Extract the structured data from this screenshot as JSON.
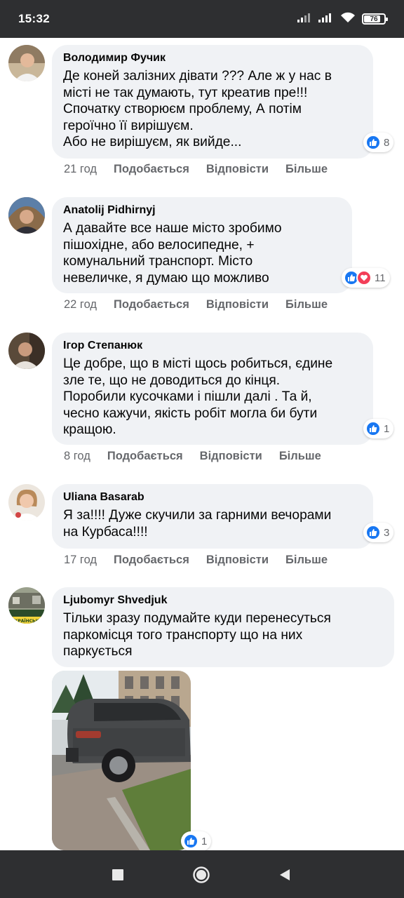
{
  "status_bar": {
    "time": "15:32",
    "battery": "76",
    "battery_level": 0.76
  },
  "comments": [
    {
      "author": "Володимир Фучик",
      "text": "Де коней залізних дівати ??? Але ж у нас в\nмісті не так думають, тут креатив пре!!!\nСпочатку створюєм проблему, А потім\nгероїчно її вирішуєм.\nАбо не вирішуєм, як вийде...",
      "time": "21 год",
      "like": "Подобається",
      "reply": "Відповісти",
      "more": "Більше",
      "reactions": [
        "like-icon"
      ],
      "reaction_count": "8"
    },
    {
      "author": "Anatolij Pidhirnyj",
      "text": "А давайте все наше місто зробимо\nпішохідне, або велосипедне, +\nкомунальний транспорт. Місто\nневеличке, я думаю що можливо",
      "time": "22 год",
      "like": "Подобається",
      "reply": "Відповісти",
      "more": "Більше",
      "reactions": [
        "like-icon",
        "heart-icon"
      ],
      "reaction_count": "11"
    },
    {
      "author": "Ігор Степанюк",
      "text": "Це добре, що в місті щось робиться, єдине\nзле те, що не доводиться до кінця.\nПоробили кусочками і пішли далі . Та й,\nчесно кажучи, якість робіт могла би бути\nкращою.",
      "time": "8 год",
      "like": "Подобається",
      "reply": "Відповісти",
      "more": "Більше",
      "reactions": [
        "like-icon"
      ],
      "reaction_count": "1"
    },
    {
      "author": "Uliana Basarab",
      "text": "Я за!!!! Дуже скучили за гарними вечорами\nна Курбаса!!!!",
      "time": "17 год",
      "like": "Подобається",
      "reply": "Відповісти",
      "more": "Більше",
      "reactions": [
        "like-icon"
      ],
      "reaction_count": "3"
    },
    {
      "author": "Ljubomyr Shvedjuk",
      "text": "Тільки зразу подумайте куди перенесуться\nпаркомісця того транспорту що на них\nпаркується",
      "reactions": [
        "like-icon"
      ],
      "reaction_count": "1",
      "avatar_badge": "УКРАЇНСЬКА"
    }
  ],
  "colors": {
    "like": "#1877f2",
    "love": "#f33e58",
    "bubble": "#f0f2f5",
    "meta": "#65676b",
    "bars": "#2e2f31"
  },
  "nav_bar": {
    "buttons": [
      "recents-square-icon",
      "home-circle-icon",
      "back-triangle-icon"
    ]
  }
}
